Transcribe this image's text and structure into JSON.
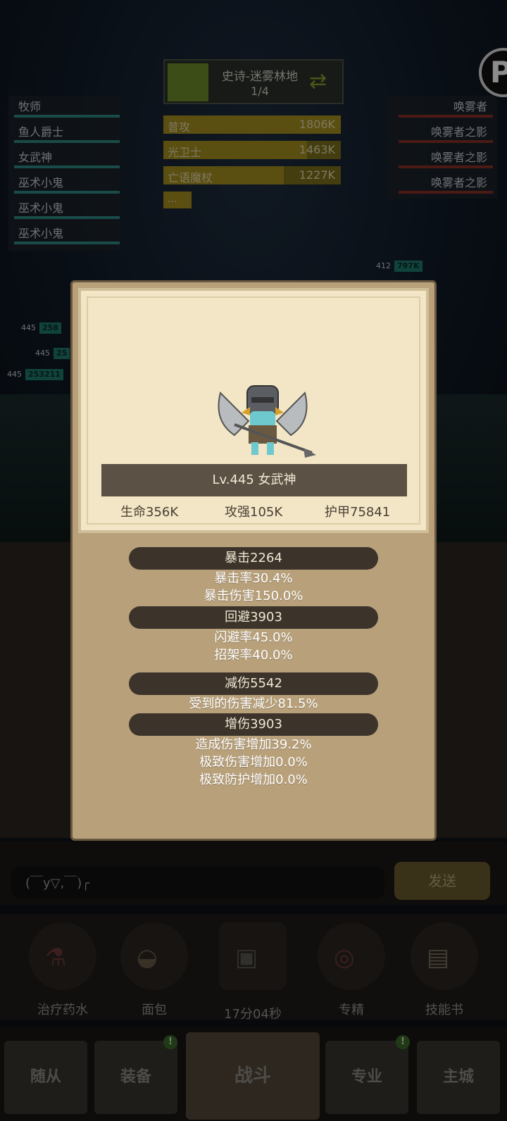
{
  "stage": {
    "name": "史诗-迷雾林地",
    "page": "1/4"
  },
  "dps_meter": {
    "rows": [
      {
        "name": "普攻",
        "value": "1806K",
        "fill": 100
      },
      {
        "name": "光卫士",
        "value": "1463K",
        "fill": 81
      },
      {
        "name": "亡语魔杖",
        "value": "1227K",
        "fill": 68
      }
    ],
    "more": "..."
  },
  "party_left": [
    "牧师",
    "鱼人爵士",
    "女武神",
    "巫术小鬼",
    "巫术小鬼",
    "巫术小鬼"
  ],
  "party_right": [
    "唤雾者",
    "唤雾者之影",
    "唤雾者之影",
    "唤雾者之影"
  ],
  "scene_tags": [
    {
      "level": "412",
      "hp": "797K"
    },
    {
      "level": "445",
      "hp": "258"
    },
    {
      "level": "445",
      "hp": "25"
    },
    {
      "level": "445",
      "hp": "253211"
    }
  ],
  "hero": {
    "title": "Lv.445 女武神",
    "hp": "生命356K",
    "attack": "攻强105K",
    "armor": "护甲75841"
  },
  "sections": [
    {
      "head": "暴击2264",
      "lines": [
        "暴击率30.4%",
        "暴击伤害150.0%"
      ]
    },
    {
      "head": "回避3903",
      "lines": [
        "闪避率45.0%",
        "招架率40.0%"
      ]
    },
    {
      "head": "减伤5542",
      "lines": [
        "受到的伤害减少81.5%"
      ]
    },
    {
      "head": "增伤3903",
      "lines": [
        "造成伤害增加39.2%",
        "极致伤害增加0.0%",
        "极致防护增加0.0%"
      ]
    }
  ],
  "chat": {
    "input_value": "(￣y▽,￣)╭",
    "send_label": "发送"
  },
  "items": [
    {
      "label": "治疗药水"
    },
    {
      "label": "面包"
    },
    {
      "label": "17分04秒"
    },
    {
      "label": "专精"
    },
    {
      "label": "技能书"
    }
  ],
  "nav": [
    {
      "label": "随从"
    },
    {
      "label": "装备"
    },
    {
      "label": "战斗"
    },
    {
      "label": "专业"
    },
    {
      "label": "主城"
    }
  ],
  "colors": {
    "popup_bg": "#b8a07a",
    "card_bg": "#f2e6c6",
    "section_pill": "#3c342b",
    "dps_bar": "#a48f20"
  }
}
